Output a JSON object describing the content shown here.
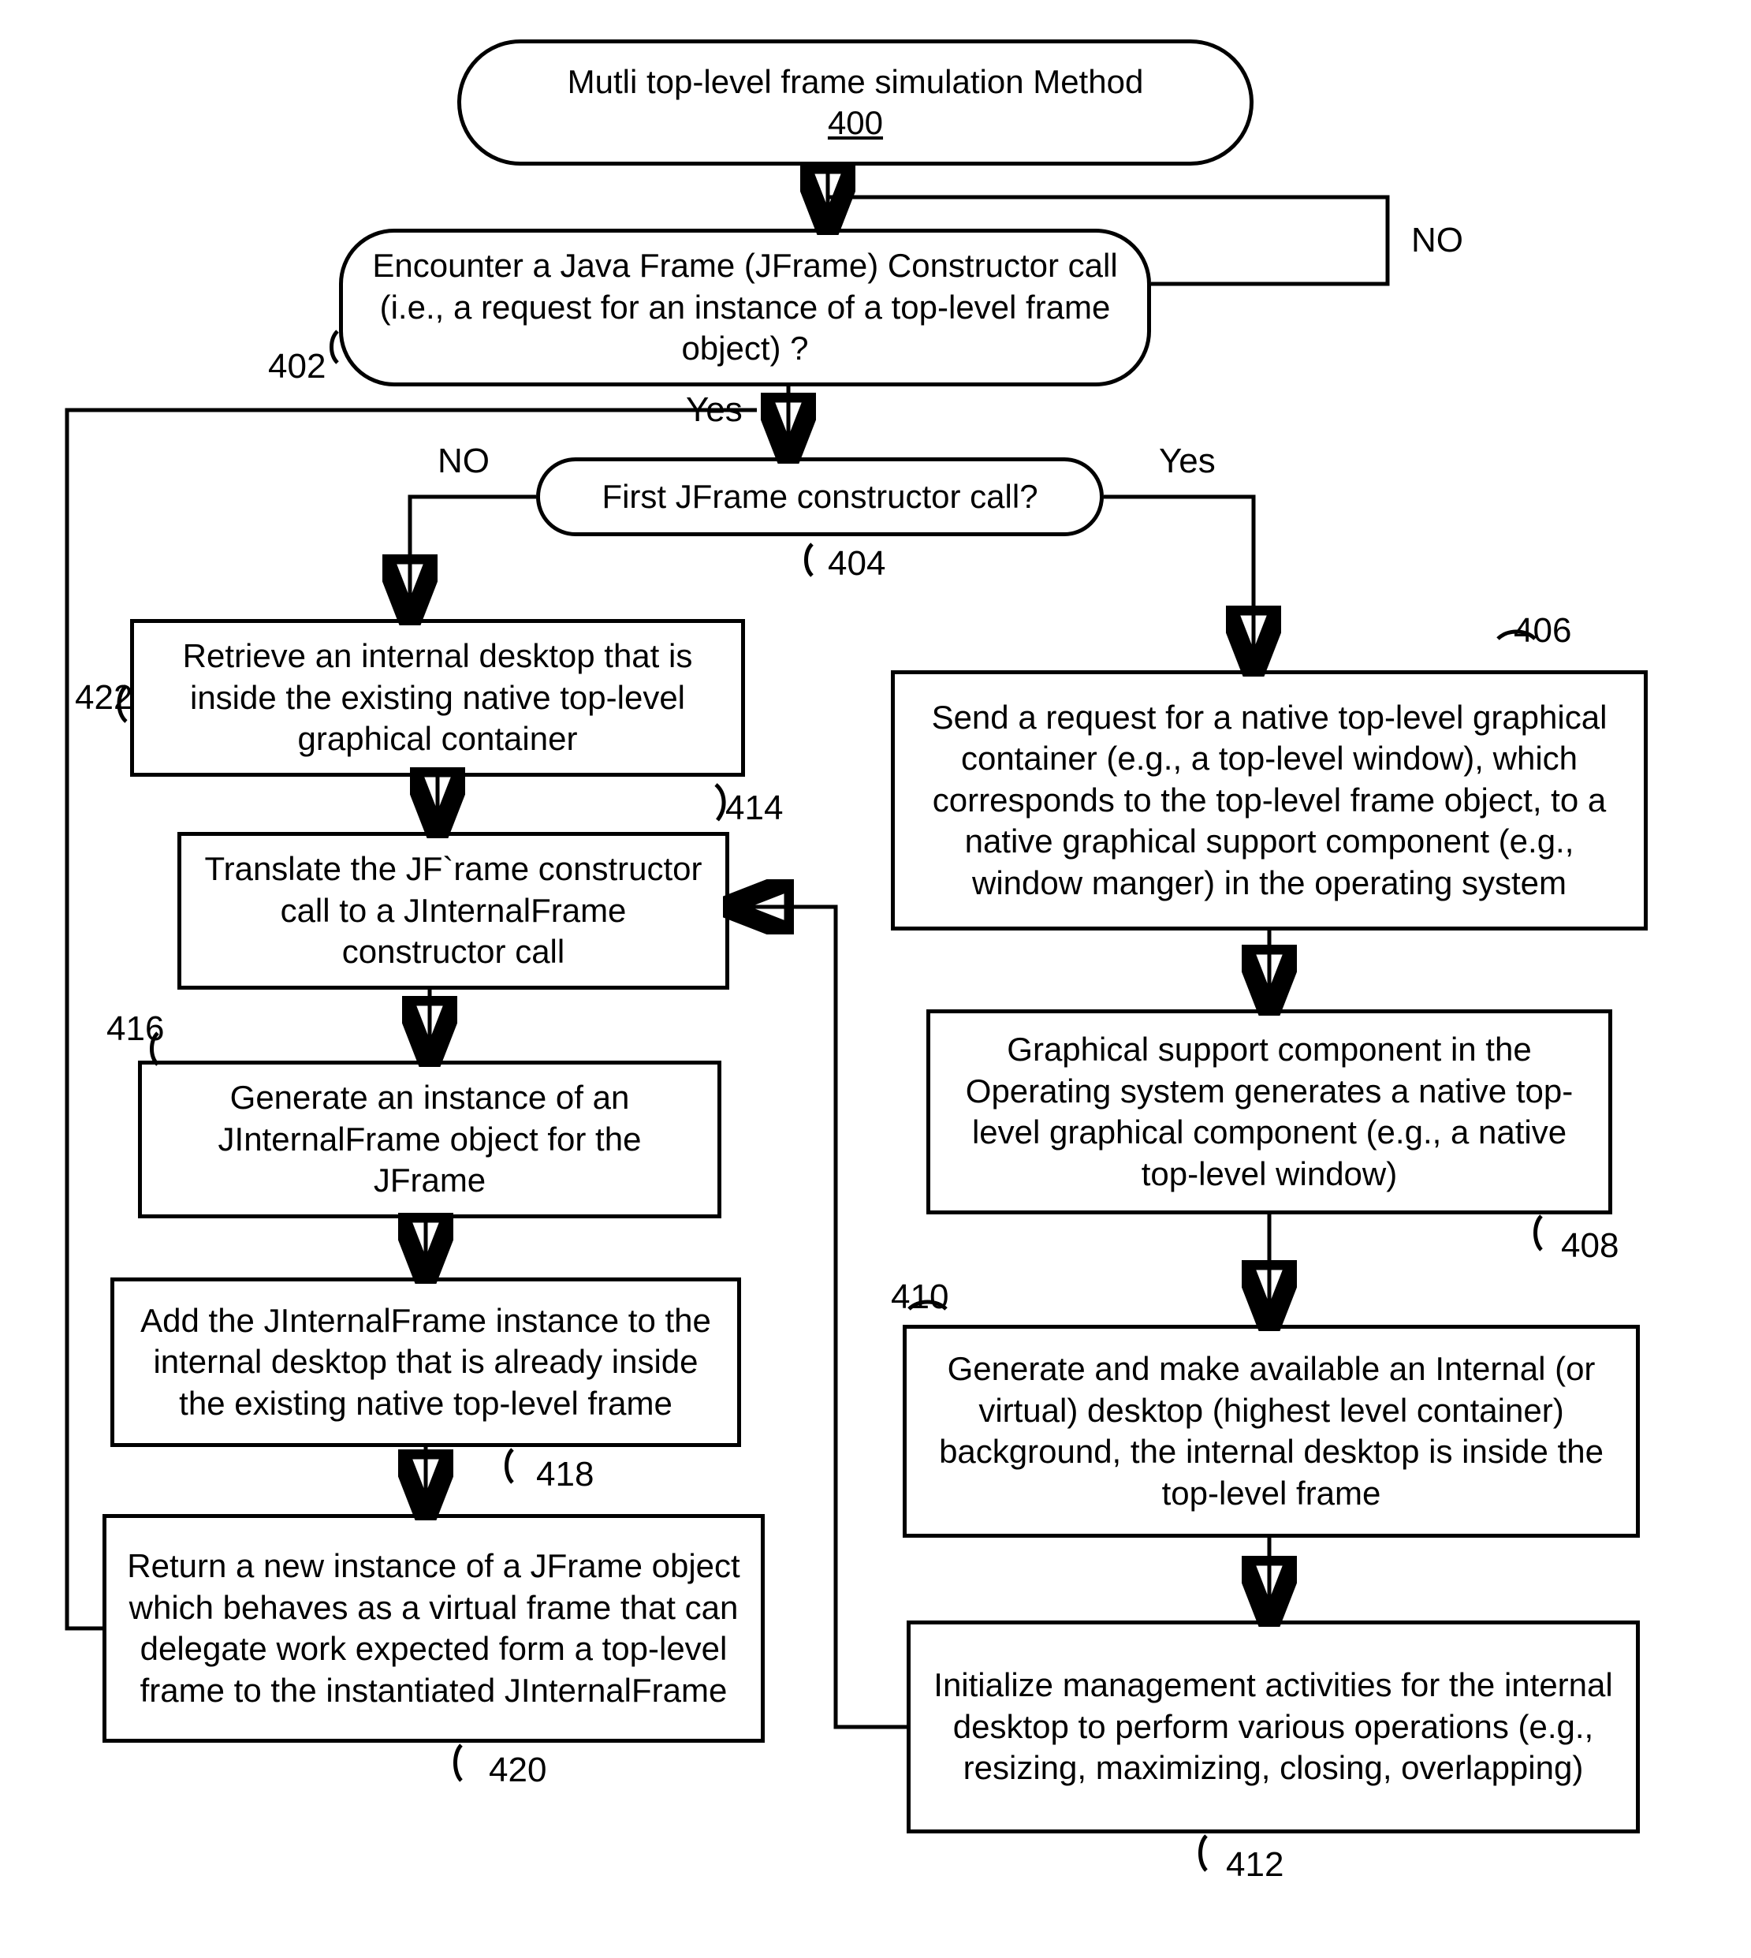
{
  "chart_data": {
    "type": "flowchart",
    "title": "Multi top-level frame simulation Method 400",
    "nodes": [
      {
        "id": "400",
        "kind": "terminator",
        "text_lines": [
          "Mutli top-level frame simulation Method",
          "400"
        ]
      },
      {
        "id": "402",
        "kind": "decision",
        "text": "Encounter a  Java Frame (JFrame) Constructor call (i.e., a request for an instance of a top-level frame object) ?"
      },
      {
        "id": "404",
        "kind": "decision",
        "text": "First JFrame constructor call?"
      },
      {
        "id": "406",
        "kind": "process",
        "text": "Send a request for a native top-level graphical container (e.g., a top-level window), which corresponds to the top-level frame object, to a native graphical support component (e.g., window manger) in the operating system"
      },
      {
        "id": "408",
        "kind": "process",
        "text": "Graphical support component in the Operating system generates a  native top-level graphical component (e.g., a native top-level window)"
      },
      {
        "id": "410",
        "kind": "process",
        "text": "Generate and make available an Internal (or virtual) desktop (highest level container) background, the internal desktop is inside the top-level frame"
      },
      {
        "id": "412",
        "kind": "process",
        "text": "Initialize management activities for the internal desktop to perform various operations (e.g., resizing, maximizing, closing, overlapping)"
      },
      {
        "id": "422",
        "kind": "process",
        "text": "Retrieve an internal desktop that is inside the existing native top-level graphical container"
      },
      {
        "id": "414",
        "kind": "process",
        "text": "Translate the JF`rame constructor call to a JInternalFrame constructor call"
      },
      {
        "id": "416",
        "kind": "process",
        "text": "Generate an instance of an JInternalFrame object for the JFrame"
      },
      {
        "id": "418",
        "kind": "process",
        "text": "Add the JInternalFrame instance to the  internal desktop that is already inside the existing native top-level frame"
      },
      {
        "id": "420",
        "kind": "process",
        "text": "Return a new instance of a JFrame object which behaves as a virtual frame that can delegate work expected form a top-level frame to the instantiated JInternalFrame"
      }
    ],
    "edges": [
      {
        "from": "400",
        "to": "402"
      },
      {
        "from": "402",
        "to": "404",
        "label": "Yes"
      },
      {
        "from": "402",
        "to": "402",
        "label": "NO",
        "note": "self-loop"
      },
      {
        "from": "404",
        "to": "406",
        "label": "Yes"
      },
      {
        "from": "404",
        "to": "422",
        "label": "NO"
      },
      {
        "from": "406",
        "to": "408"
      },
      {
        "from": "408",
        "to": "410"
      },
      {
        "from": "410",
        "to": "412"
      },
      {
        "from": "412",
        "to": "414"
      },
      {
        "from": "422",
        "to": "414"
      },
      {
        "from": "414",
        "to": "416"
      },
      {
        "from": "416",
        "to": "418"
      },
      {
        "from": "418",
        "to": "420"
      },
      {
        "from": "420",
        "to": "402",
        "note": "loop back"
      }
    ],
    "labels": {
      "no": "NO",
      "yes_lower": "Yes",
      "yes": "Yes"
    },
    "refs": {
      "r400": "400",
      "r402": "402",
      "r404": "404",
      "r406": "406",
      "r408": "408",
      "r410": "410",
      "r412": "412",
      "r414": "414",
      "r416": "416",
      "r418": "418",
      "r420": "420",
      "r422": "422"
    }
  }
}
